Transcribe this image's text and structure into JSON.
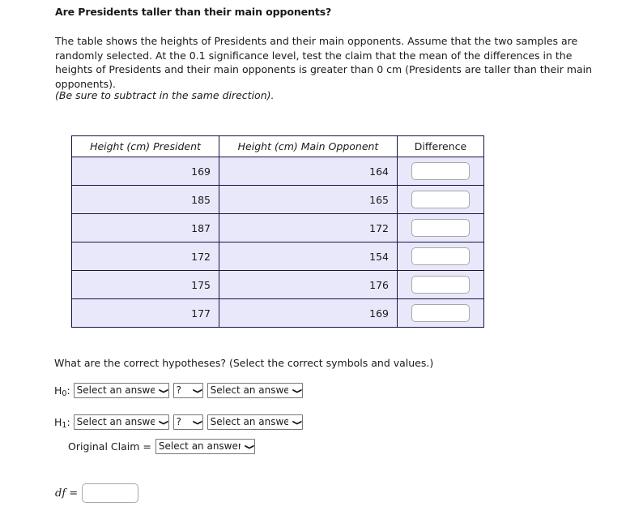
{
  "heading": "Are Presidents taller than their main opponents?",
  "intro": "The table shows the heights of Presidents and their main opponents. Assume that the two samples are randomly selected. At the 0.1 significance level, test the claim that the mean of the differences in the heights of Presidents and their main opponents is greater than 0 cm (Presidents are taller than their main opponents).",
  "intro_note": "(Be sure to subtract in the same direction).",
  "table": {
    "headers": {
      "president": "Height (cm) President",
      "opponent": "Height (cm) Main Opponent",
      "difference": "Difference"
    },
    "rows": [
      {
        "president": "169",
        "opponent": "164",
        "difference": ""
      },
      {
        "president": "185",
        "opponent": "165",
        "difference": ""
      },
      {
        "president": "187",
        "opponent": "172",
        "difference": ""
      },
      {
        "president": "172",
        "opponent": "154",
        "difference": ""
      },
      {
        "president": "175",
        "opponent": "176",
        "difference": ""
      },
      {
        "president": "177",
        "opponent": "169",
        "difference": ""
      }
    ],
    "cell_background": "#e9e8fb",
    "border_color": "#151544"
  },
  "hypotheses": {
    "question": "What are the correct hypotheses? (Select the correct symbols and values.)",
    "h0_label": "H",
    "h0_sub": "0",
    "h1_label": "H",
    "h1_sub": "1",
    "colon": ":",
    "select_placeholder": "Select an answer",
    "operator_placeholder": "?",
    "chevron_icon": "⌄",
    "h0": {
      "parameter": "Select an answer",
      "operator": "?",
      "value": "Select an answer"
    },
    "h1": {
      "parameter": "Select an answer",
      "operator": "?",
      "value": "Select an answer"
    },
    "original_claim_label": "Original Claim =",
    "original_claim_value": "Select an answer"
  },
  "df": {
    "label": "df =",
    "value": ""
  }
}
